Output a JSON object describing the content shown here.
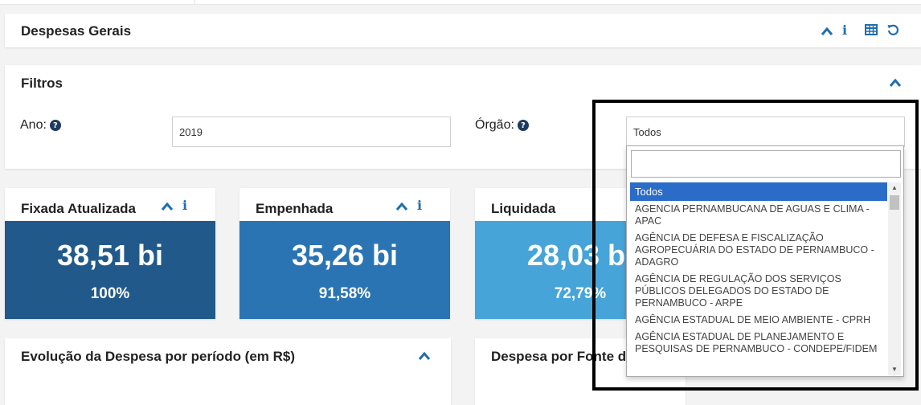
{
  "colors": {
    "accent": "#1f6db3",
    "kpi_fixada": "#215a8a",
    "kpi_empenhada": "#2b74b4",
    "kpi_liquidada": "#47a4d8",
    "selected_option": "#2a6cc7"
  },
  "header": {
    "title": "Despesas Gerais",
    "icons": [
      "chevron-up-icon",
      "info-icon",
      "table-icon",
      "reset-icon"
    ],
    "info_glyph": "i"
  },
  "filters": {
    "title": "Filtros",
    "ano": {
      "label": "Ano:",
      "help_glyph": "?",
      "value": "2019"
    },
    "orgao": {
      "label": "Órgão:",
      "help_glyph": "?",
      "value": "Todos"
    }
  },
  "kpis": [
    {
      "title": "Fixada Atualizada",
      "value": "38,51 bi",
      "percent": "100%"
    },
    {
      "title": "Empenhada",
      "value": "35,26 bi",
      "percent": "91,58%"
    },
    {
      "title": "Liquidada",
      "value": "28,03 bi",
      "percent": "72,79%"
    }
  ],
  "sections": {
    "evolucao_title": "Evolução da Despesa por período (em R$)",
    "fonte_title": "Despesa por Fonte d"
  },
  "dropdown": {
    "search_value": "",
    "options": [
      "Todos",
      "AGENCIA PERNAMBUCANA DE AGUAS E CLIMA - APAC",
      "AGÊNCIA DE DEFESA E FISCALIZAÇÃO AGROPECUÁRIA DO ESTADO DE PERNAMBUCO - ADAGRO",
      "AGÊNCIA DE REGULAÇÃO DOS SERVIÇOS PÚBLICOS DELEGADOS DO ESTADO DE PERNAMBUCO - ARPE",
      "AGÊNCIA ESTADUAL DE MEIO AMBIENTE - CPRH",
      "AGÊNCIA ESTADUAL DE PLANEJAMENTO E PESQUISAS DE PERNAMBUCO - CONDEPE/FIDEM"
    ]
  }
}
